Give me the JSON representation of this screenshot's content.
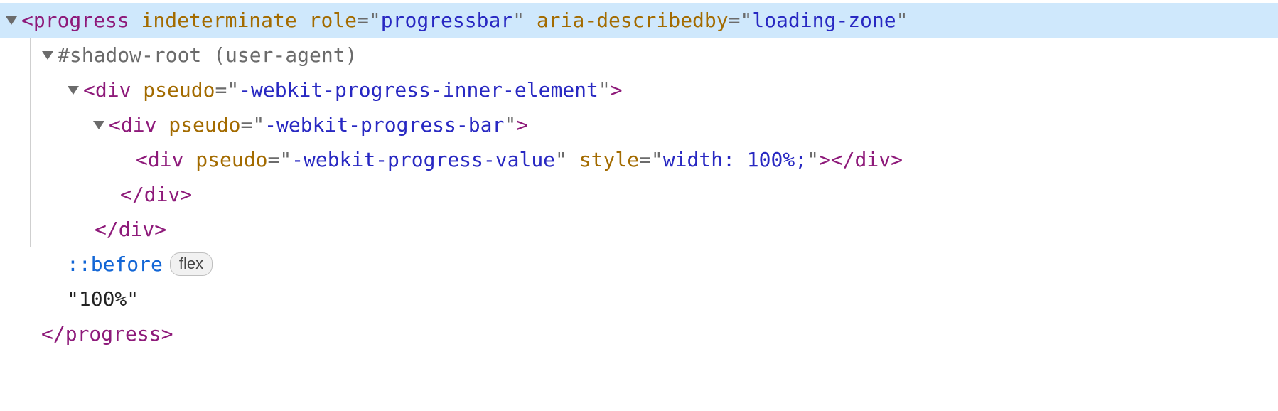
{
  "lines": [
    {
      "open_bracket": "<",
      "tag": "progress",
      "attrs": [
        {
          "name": "indeterminate",
          "value": null
        },
        {
          "name": "role",
          "value": "progressbar"
        },
        {
          "name": "aria-describedby",
          "value": "loading-zone"
        }
      ],
      "close_bracket": ""
    },
    {
      "shadow_text": "#shadow-root (user-agent)"
    },
    {
      "open_bracket": "<",
      "tag": "div",
      "attrs": [
        {
          "name": "pseudo",
          "value": "-webkit-progress-inner-element"
        }
      ],
      "close_bracket": ">"
    },
    {
      "open_bracket": "<",
      "tag": "div",
      "attrs": [
        {
          "name": "pseudo",
          "value": "-webkit-progress-bar"
        }
      ],
      "close_bracket": ">"
    },
    {
      "open_bracket": "<",
      "tag": "div",
      "attrs": [
        {
          "name": "pseudo",
          "value": "-webkit-progress-value"
        },
        {
          "name": "style",
          "value": "width: 100%;"
        }
      ],
      "close_bracket": ">",
      "end_open": "</",
      "end_tag": "div",
      "end_close": ">"
    },
    {
      "end_open": "</",
      "end_tag": "div",
      "end_close": ">"
    },
    {
      "end_open": "</",
      "end_tag": "div",
      "end_close": ">"
    },
    {
      "pseudo_selector": "::before",
      "badge": "flex"
    },
    {
      "text_node": "\"100%\""
    },
    {
      "end_open": "</",
      "end_tag": "progress",
      "end_close": ">"
    }
  ]
}
